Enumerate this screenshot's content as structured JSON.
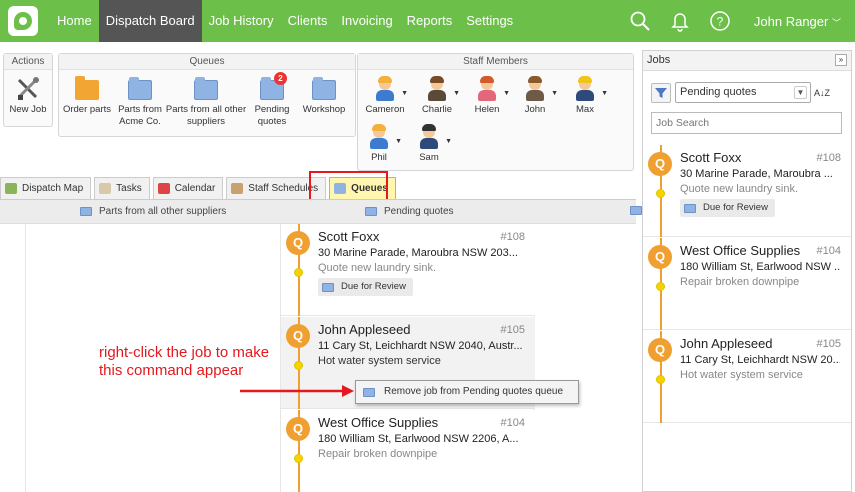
{
  "nav": {
    "items": [
      "Home",
      "Dispatch Board",
      "Job History",
      "Clients",
      "Invoicing",
      "Reports",
      "Settings"
    ],
    "active_index": 1,
    "user": "John Ranger",
    "icons": [
      "search-icon",
      "bell-icon",
      "help-icon"
    ]
  },
  "ribbon": {
    "actions": {
      "title": "Actions",
      "new_job": "New Job"
    },
    "queues": {
      "title": "Queues",
      "items": [
        {
          "label": "Order parts",
          "color": "orange"
        },
        {
          "label": "Parts from Acme Co.",
          "color": "blue"
        },
        {
          "label": "Parts from all other suppliers",
          "color": "blue"
        },
        {
          "label": "Pending quotes",
          "color": "blue",
          "badge": "2"
        },
        {
          "label": "Workshop",
          "color": "blue"
        }
      ]
    },
    "staff": {
      "title": "Staff Members",
      "members": [
        "Cameron",
        "Charlie",
        "Helen",
        "John",
        "Max",
        "Phil",
        "Sam"
      ]
    }
  },
  "tabs": [
    "Dispatch Map",
    "Tasks",
    "Calendar",
    "Staff Schedules",
    "Queues"
  ],
  "active_tab": "Queues",
  "queue_columns": [
    "Parts from all other suppliers",
    "Pending quotes"
  ],
  "queue_jobs": [
    {
      "initial": "Q",
      "name": "Scott Foxx",
      "number": "#108",
      "address": "30 Marine Parade, Maroubra NSW 203...",
      "description": "Quote new laundry sink.",
      "tag": "Due for Review"
    },
    {
      "initial": "Q",
      "name": "John Appleseed",
      "number": "#105",
      "address": "11 Cary St, Leichhardt NSW 2040, Austr...",
      "description": "Hot water system service"
    },
    {
      "initial": "Q",
      "name": "West Office Supplies",
      "number": "#104",
      "address": "180 William St, Earlwood NSW 2206, A...",
      "description": "Repair broken downpipe"
    }
  ],
  "context_menu": {
    "label": "Remove job from Pending quotes queue"
  },
  "annotation": "right-click the job to make this command appear",
  "jobs_panel": {
    "title": "Jobs",
    "collapse_label": "»",
    "filter_value": "Pending quotes",
    "sort_label": "A↓Z",
    "search_placeholder": "Job Search",
    "jobs": [
      {
        "initial": "Q",
        "name": "Scott Foxx",
        "number": "#108",
        "address": "30 Marine Parade, Maroubra ...",
        "description": "Quote new laundry sink.",
        "tag": "Due for Review"
      },
      {
        "initial": "Q",
        "name": "West Office Supplies",
        "number": "#104",
        "address": "180 William St, Earlwood NSW ...",
        "description": "Repair broken downpipe"
      },
      {
        "initial": "Q",
        "name": "John Appleseed",
        "number": "#105",
        "address": "11 Cary St, Leichhardt NSW 20...",
        "description": "Hot water system service"
      }
    ]
  },
  "colors": {
    "brand_green": "#6cc04a",
    "nav_active": "#555555",
    "job_orange": "#f0a030",
    "highlight_red": "#e4181e",
    "status_yellow": "#f5d400"
  }
}
